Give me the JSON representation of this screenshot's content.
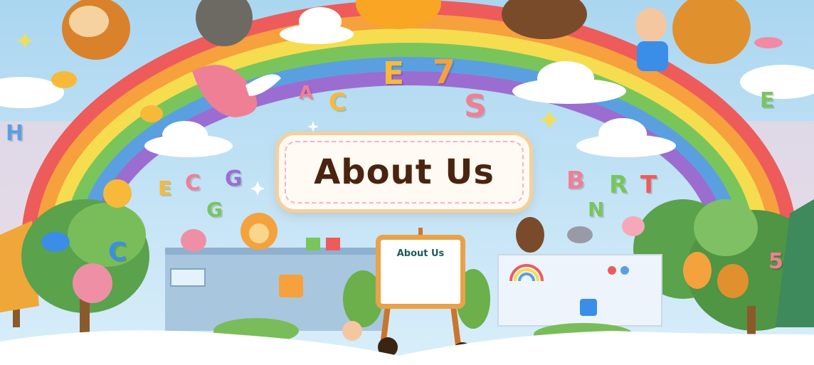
{
  "banner": {
    "title": "About Us",
    "board_title": "About Us"
  },
  "floating_letters": [
    "A",
    "C",
    "E",
    "7",
    "S",
    "H",
    "E",
    "E",
    "C",
    "G",
    "G",
    "C",
    "B",
    "R",
    "T",
    "N",
    "5"
  ],
  "colors": {
    "sky": "#b9ddf2",
    "title_text": "#4a2410",
    "card_border": "#f7cf9a",
    "ground": "#ffffff"
  }
}
